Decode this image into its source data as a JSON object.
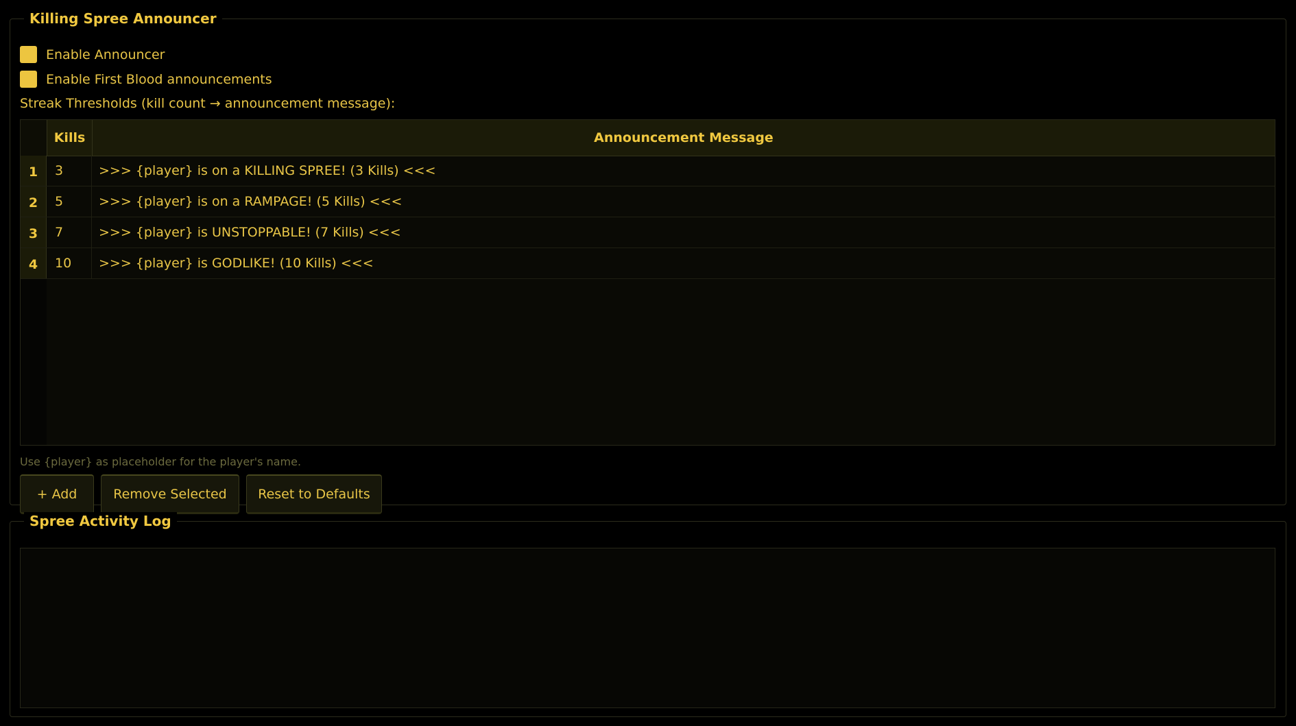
{
  "announcer": {
    "title": "Killing Spree Announcer",
    "enable_label": "Enable Announcer",
    "enable_checked": true,
    "firstblood_label": "Enable First Blood announcements",
    "firstblood_checked": true,
    "thresholds_label": "Streak Thresholds (kill count → announcement message):",
    "table": {
      "columns": [
        "Kills",
        "Announcement Message"
      ],
      "rows": [
        {
          "num": "1",
          "kills": "3",
          "message": ">>> {player} is on a KILLING SPREE! (3 Kills) <<<"
        },
        {
          "num": "2",
          "kills": "5",
          "message": ">>> {player} is on a RAMPAGE! (5 Kills) <<<"
        },
        {
          "num": "3",
          "kills": "7",
          "message": ">>> {player} is UNSTOPPABLE! (7 Kills) <<<"
        },
        {
          "num": "4",
          "kills": "10",
          "message": ">>> {player} is GODLIKE! (10 Kills) <<<"
        }
      ]
    },
    "hint": "Use {player} as placeholder for the player's name.",
    "buttons": {
      "add": "+ Add",
      "remove": "Remove Selected",
      "reset": "Reset to Defaults"
    }
  },
  "log": {
    "title": "Spree Activity Log",
    "content": ""
  },
  "colors": {
    "accent": "#edc540",
    "background": "#000000",
    "header_bg": "#1b1b08",
    "hint_text": "#6b6a3e"
  }
}
